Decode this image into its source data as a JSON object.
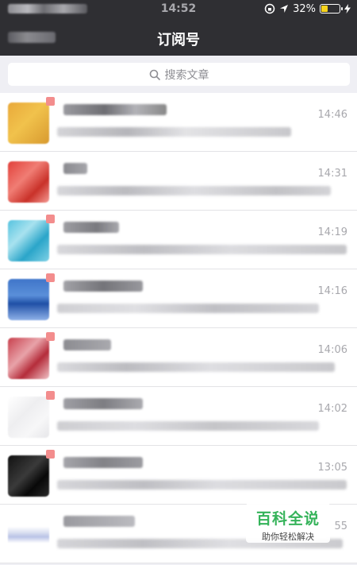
{
  "status_bar": {
    "time": "14:52",
    "battery_text": "32%",
    "battery_level": 0.32
  },
  "nav": {
    "title": "订阅号",
    "back_icon": "back-arrow-icon"
  },
  "search": {
    "placeholder": "搜索文章",
    "icon": "search-icon"
  },
  "colors": {
    "nav_bg": "#2f2f33",
    "unread_dot": "#f38d8d",
    "time_text": "#a8a8ad",
    "watermark_green": "#35b35a"
  },
  "rows": [
    {
      "time": "14:46"
    },
    {
      "time": "14:31"
    },
    {
      "time": "14:19"
    },
    {
      "time": "14:16"
    },
    {
      "time": "14:06"
    },
    {
      "time": "14:02"
    },
    {
      "time": "13:05"
    },
    {
      "time": "55"
    }
  ],
  "watermark": {
    "main": "百科全说",
    "sub": "助你轻松解决"
  }
}
